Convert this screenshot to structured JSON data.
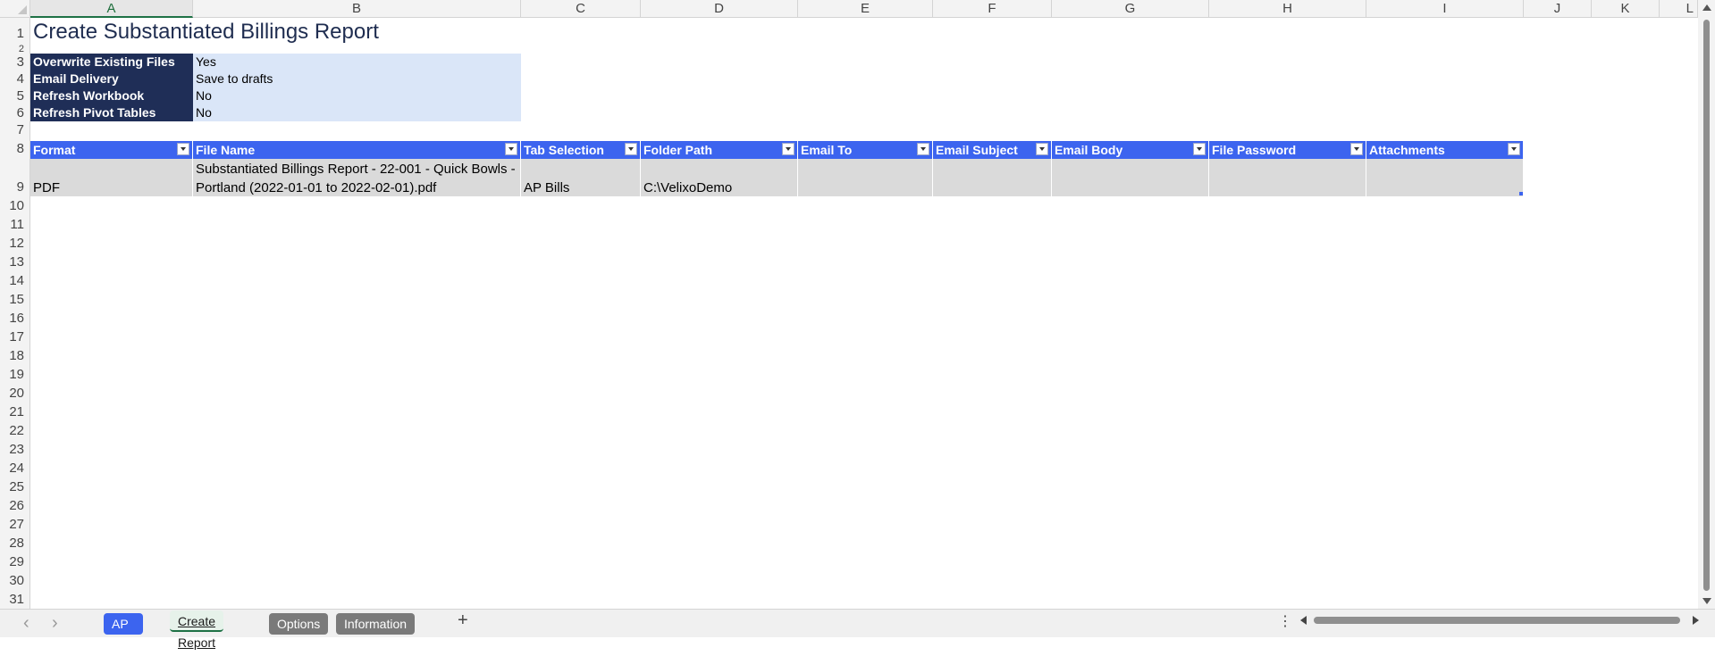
{
  "columns": [
    "A",
    "B",
    "C",
    "D",
    "E",
    "F",
    "G",
    "H",
    "I",
    "J",
    "K",
    "L"
  ],
  "rows": [
    "1",
    "2",
    "3",
    "4",
    "5",
    "6",
    "7",
    "8",
    "9",
    "10",
    "11",
    "12",
    "13",
    "14",
    "15",
    "16",
    "17",
    "18",
    "19",
    "20",
    "21",
    "22",
    "23",
    "24",
    "25",
    "26",
    "27",
    "28",
    "29",
    "30",
    "31"
  ],
  "title": "Create Substantiated Billings Report",
  "options": [
    {
      "label": "Overwrite Existing Files",
      "value": "Yes"
    },
    {
      "label": "Email Delivery",
      "value": "Save to drafts"
    },
    {
      "label": "Refresh Workbook",
      "value": "No"
    },
    {
      "label": "Refresh Pivot Tables",
      "value": "No"
    }
  ],
  "table": {
    "headers": [
      "Format",
      "File Name",
      "Tab Selection",
      "Folder Path",
      "Email To",
      "Email Subject",
      "Email Body",
      "File Password",
      "Attachments"
    ],
    "row": {
      "format": "PDF",
      "file_name": "Substantiated Billings Report - 22-001 - Quick Bowls - Portland (2022-01-01 to 2022-02-01).pdf",
      "tab_selection": "AP Bills",
      "folder_path": "C:\\VelixoDemo",
      "email_to": "",
      "email_subject": "",
      "email_body": "",
      "file_password": "",
      "attachments": ""
    }
  },
  "sheet_tabs": [
    {
      "label": "AP Bills"
    },
    {
      "label": "Create Report"
    },
    {
      "label": "Options"
    },
    {
      "label": "Information"
    }
  ],
  "active_column": "A",
  "colors": {
    "header_blue": "#3c64ef",
    "label_navy": "#1f2e57",
    "value_blue": "#dae6f8",
    "row_gray": "#dadada"
  }
}
